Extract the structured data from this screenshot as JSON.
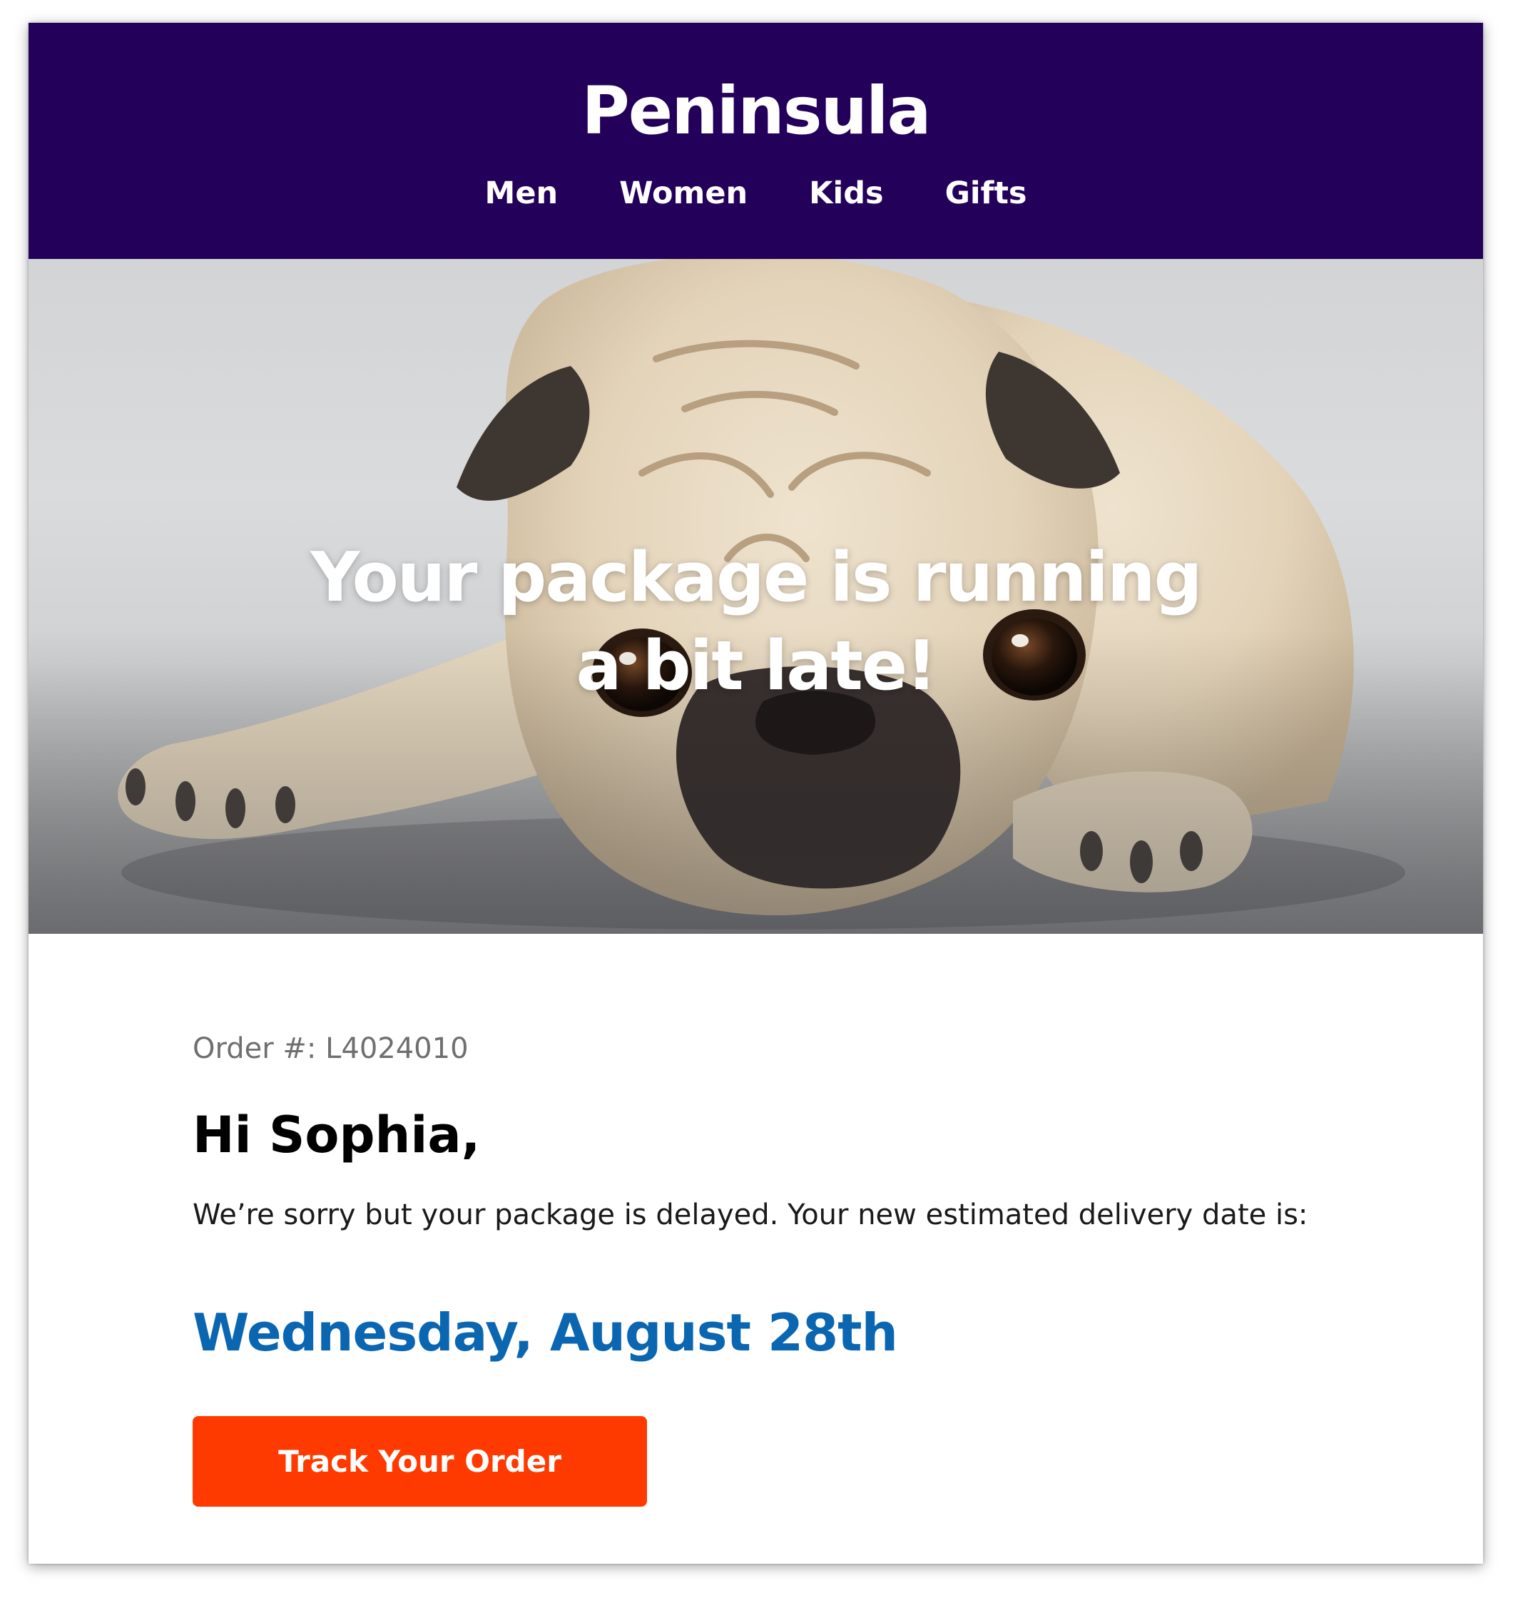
{
  "header": {
    "brand": "Peninsula",
    "nav": [
      {
        "label": "Men"
      },
      {
        "label": "Women"
      },
      {
        "label": "Kids"
      },
      {
        "label": "Gifts"
      }
    ],
    "background_color": "#23005a"
  },
  "hero": {
    "headline_line1": "Your package is running",
    "headline_line2": "a bit late!",
    "image_subject": "pug lying down"
  },
  "body": {
    "order_label": "Order #: L4024010",
    "greeting": "Hi Sophia,",
    "message": "We’re sorry but your package is delayed. Your new estimated delivery date is:",
    "delivery_date": "Wednesday, August 28th",
    "date_color": "#0a66b0"
  },
  "cta": {
    "label": "Track Your Order",
    "color": "#ff3a00"
  }
}
